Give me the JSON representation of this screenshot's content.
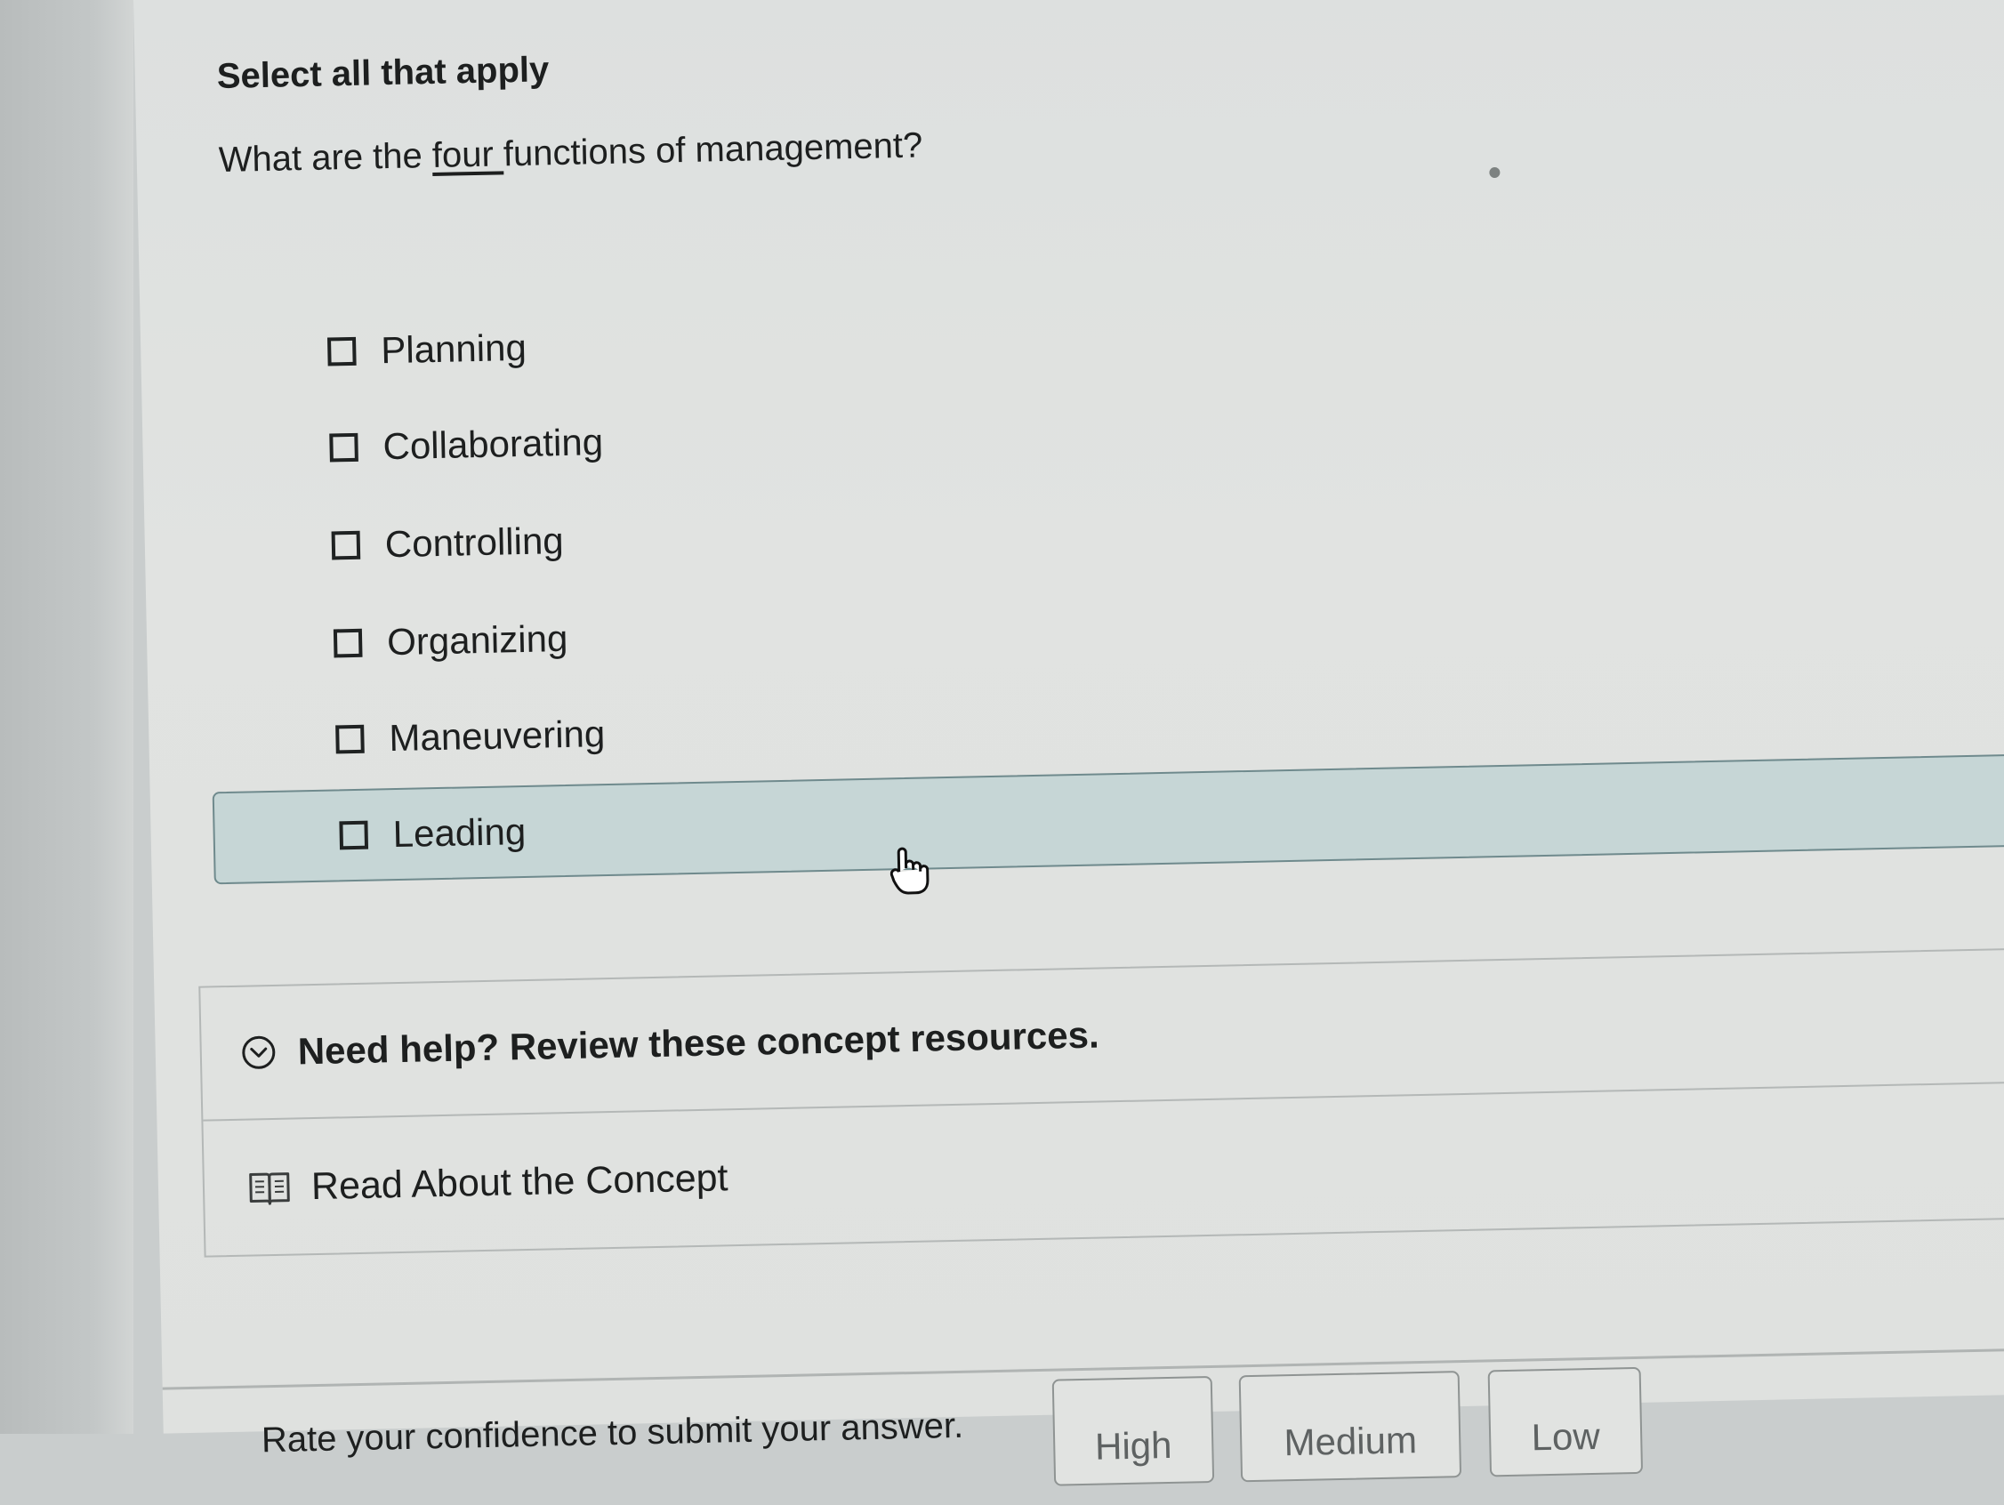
{
  "question": {
    "instruction": "Select all that apply",
    "text_before": "What are the ",
    "text_emphasis": "four ",
    "text_after": "functions of management?"
  },
  "options": [
    {
      "label": "Planning",
      "checked": false
    },
    {
      "label": "Collaborating",
      "checked": false
    },
    {
      "label": "Controlling",
      "checked": false
    },
    {
      "label": "Organizing",
      "checked": false
    },
    {
      "label": "Maneuvering",
      "checked": false
    },
    {
      "label": "Leading",
      "checked": false
    }
  ],
  "help": {
    "title": "Need help? Review these concept resources.",
    "resource_label": "Read About the Concept",
    "icons": {
      "toggle": "chevron-down-circle-icon",
      "resource": "book-icon"
    }
  },
  "confidence": {
    "prompt": "Rate your confidence to submit your answer.",
    "buttons": [
      "High",
      "Medium",
      "Low"
    ]
  },
  "colors": {
    "hover_background": "#c6d6d6",
    "hover_border": "#6f8a8d",
    "text": "#1d1f1f"
  }
}
